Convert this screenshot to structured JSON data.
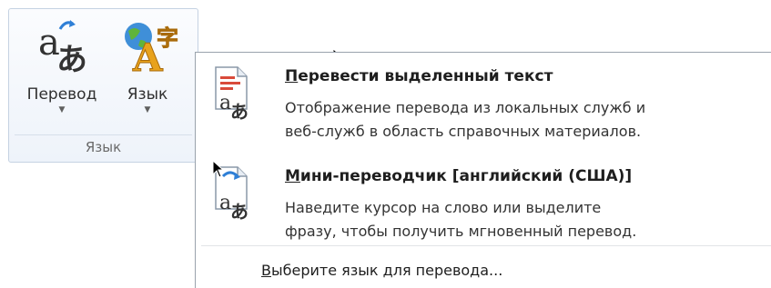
{
  "ribbon": {
    "translate_button": {
      "label": "Перевод",
      "icon": "translate-icon"
    },
    "language_button": {
      "label": "Язык",
      "icon": "language-globe-icon"
    },
    "group_label": "Язык"
  },
  "menu": {
    "item1": {
      "title_accel": "П",
      "title_rest": "еревести выделенный текст",
      "desc_line1": "Отображение перевода из локальных служб и",
      "desc_line2": "веб-служб в область справочных материалов.",
      "icon": "translate-document-icon"
    },
    "item2": {
      "title_accel": "М",
      "title_rest": "ини-переводчик [английский (США)]",
      "desc_line1": "Наведите курсор на слово или выделите",
      "desc_line2": "фразу, чтобы получить мгновенный перевод.",
      "icon": "mini-translator-icon"
    },
    "choose_language": {
      "accel": "В",
      "rest": "ыберите язык для перевода..."
    }
  },
  "colors": {
    "ribbon_bg": "#eef3fa",
    "ribbon_border": "#c5d2e2",
    "menu_border": "#9aa3ad",
    "text": "#1e1e1e"
  }
}
